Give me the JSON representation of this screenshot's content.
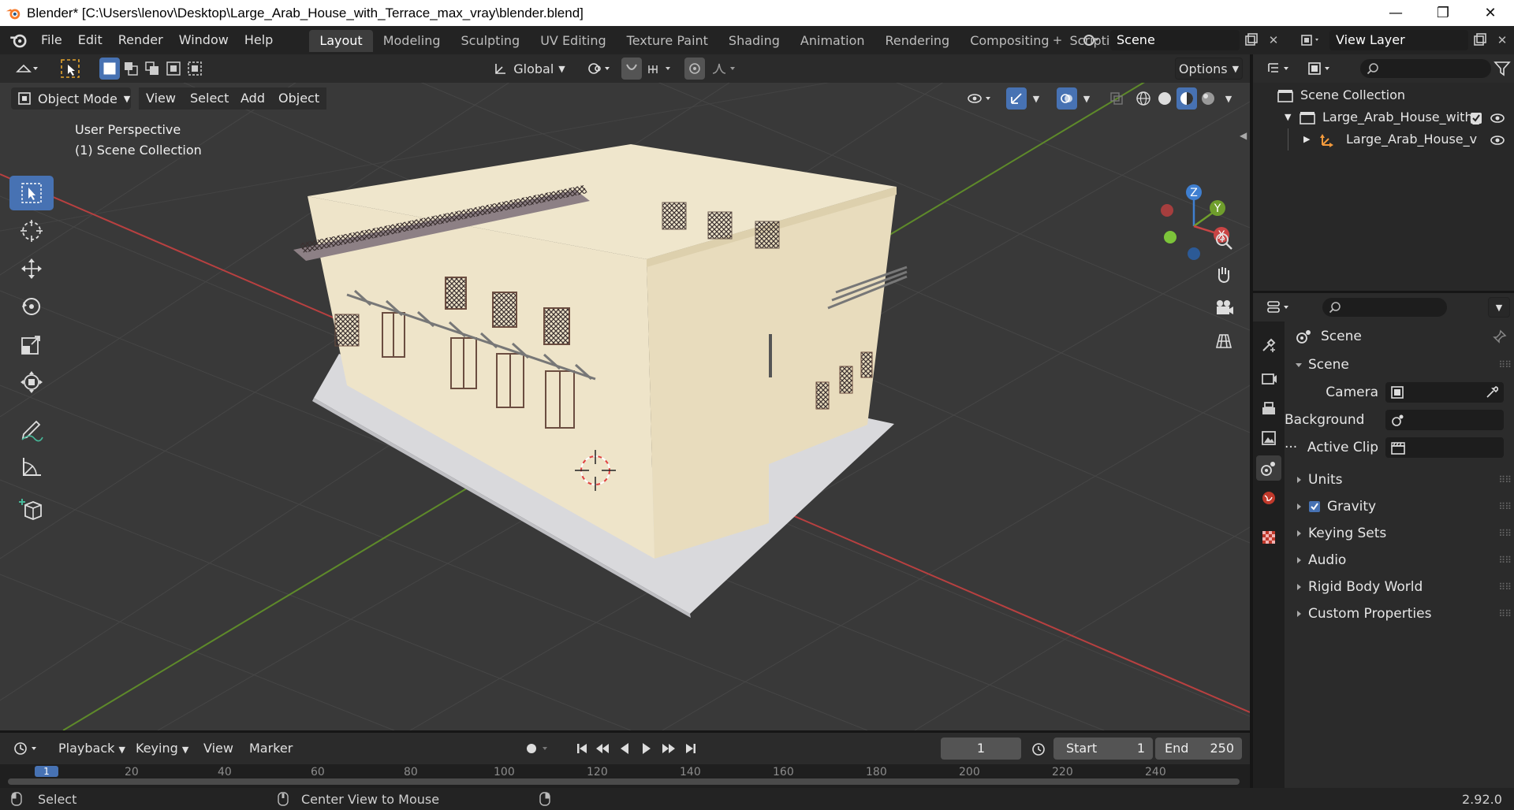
{
  "window": {
    "title": "Blender* [C:\\Users\\lenov\\Desktop\\Large_Arab_House_with_Terrace_max_vray\\blender.blend]",
    "minimize": "—",
    "restore": "❐",
    "close": "✕"
  },
  "menu": [
    "File",
    "Edit",
    "Render",
    "Window",
    "Help"
  ],
  "workspaces": [
    "Layout",
    "Modeling",
    "Sculpting",
    "UV Editing",
    "Texture Paint",
    "Shading",
    "Animation",
    "Rendering",
    "Compositing",
    "Scripting"
  ],
  "active_workspace": "Layout",
  "scene_name": "Scene",
  "view_layer": "View Layer",
  "viewport": {
    "transform_orientation": "Global",
    "options_label": "Options",
    "mode": "Object Mode",
    "menus": [
      "View",
      "Select",
      "Add",
      "Object"
    ],
    "perspective_label": "User Perspective",
    "collection_label": "(1) Scene Collection",
    "gizmo_axes": {
      "x": "X",
      "y": "Y",
      "z": "Z"
    },
    "colors": {
      "x_axis": "#c94545",
      "y_axis": "#6f9e2c",
      "z_axis": "#3f7fd0",
      "accent": "#4772b3"
    }
  },
  "timeline": {
    "menus": [
      "Playback",
      "Keying",
      "View",
      "Marker"
    ],
    "current_frame": "1",
    "start_label": "Start",
    "start": "1",
    "end_label": "End",
    "end": "250",
    "ruler_ticks": [
      "20",
      "40",
      "60",
      "80",
      "100",
      "120",
      "140",
      "160",
      "180",
      "200",
      "220",
      "240"
    ],
    "cursor_frame": "1"
  },
  "statusbar": {
    "left": "Select",
    "middle": "Center View to Mouse",
    "version": "2.92.0"
  },
  "outliner": {
    "root": "Scene Collection",
    "items": [
      {
        "label": "Large_Arab_House_with_"
      },
      {
        "label": "Large_Arab_House_v"
      }
    ]
  },
  "properties": {
    "context_title": "Scene",
    "panel_title": "Scene",
    "fields": [
      {
        "label": "Camera"
      },
      {
        "label": "Background ..."
      },
      {
        "label": "Active Clip"
      }
    ],
    "sections": [
      {
        "label": "Units"
      },
      {
        "label": "Gravity",
        "checked": true
      },
      {
        "label": "Keying Sets"
      },
      {
        "label": "Audio"
      },
      {
        "label": "Rigid Body World"
      },
      {
        "label": "Custom Properties"
      }
    ]
  }
}
